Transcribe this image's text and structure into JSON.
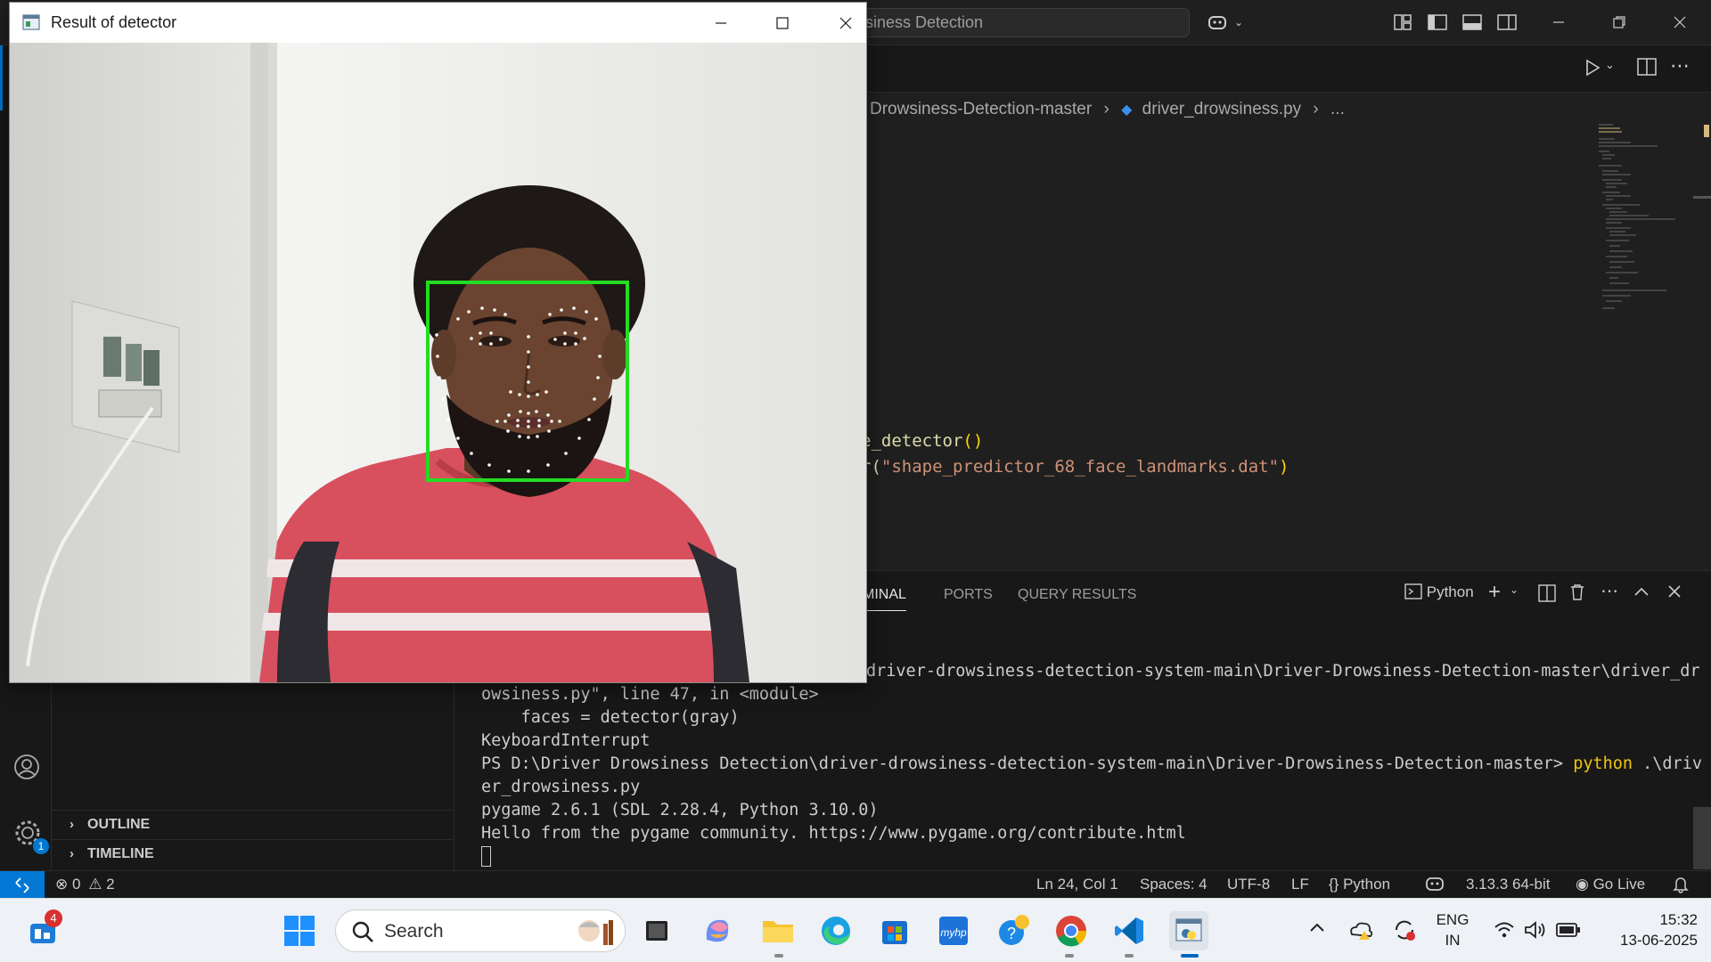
{
  "vscode": {
    "command_center": "siness Detection",
    "breadcrumb": [
      "Drowsiness-Detection-master",
      "driver_drowsiness.py",
      "..."
    ],
    "code_lines": [
      {
        "text": "e_detector",
        "suffix": "()"
      },
      {
        "prefix": "r(",
        "string": "\"shape_predictor_68_face_landmarks.dat\"",
        "suffix": ")"
      }
    ],
    "sidebar_sections": [
      "OUTLINE",
      "TIMELINE"
    ],
    "panel_tabs": [
      "MINAL",
      "PORTS",
      "QUERY RESULTS"
    ],
    "terminal_profile": "Python",
    "terminal_lines": [
      "driver-drowsiness-detection-system-main\\Driver-Drowsiness-Detection-master\\driver_dr",
      "owsiness.py\", line 47, in <module>",
      "    faces = detector(gray)",
      "KeyboardInterrupt",
      "er_drowsiness.py",
      "pygame 2.6.1 (SDL 2.28.4, Python 3.10.0)",
      "Hello from the pygame community. https://www.pygame.org/contribute.html"
    ],
    "prompt_line": {
      "path": "PS D:\\Driver Drowsiness Detection\\driver-drowsiness-detection-system-main\\Driver-Drowsiness-Detection-master>",
      "command": "python",
      "arg": ".\\driv"
    },
    "status": {
      "errors": "0",
      "warnings": "2",
      "position": "Ln 24, Col 1",
      "spaces": "Spaces: 4",
      "encoding": "UTF-8",
      "eol": "LF",
      "language": "Python",
      "interpreter": "3.13.3 64-bit",
      "golive": "Go Live"
    },
    "settings_badge": "1"
  },
  "detector_window": {
    "title": "Result of detector"
  },
  "taskbar": {
    "search_placeholder": "Search",
    "widgets_badge": "4",
    "lang_line1": "ENG",
    "lang_line2": "IN",
    "time": "15:32",
    "date": "13-06-2025"
  },
  "colors": {
    "accent": "#0078d4",
    "detection_box": "#22dd22",
    "shirt": "#d8505e"
  }
}
